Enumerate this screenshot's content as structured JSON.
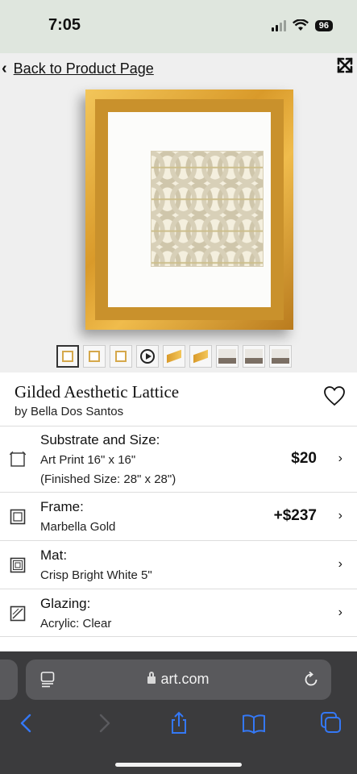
{
  "status_bar": {
    "time": "7:05",
    "battery": "96"
  },
  "nav": {
    "back_label": "Back to Product Page"
  },
  "product": {
    "title": "Gilded Aesthetic Lattice",
    "artist": "by Bella Dos Santos"
  },
  "options": [
    {
      "title": "Substrate and Size:",
      "line1": "Art Print 16\" x 16\"",
      "line2": "(Finished Size: 28\" x 28\")",
      "price": "$20",
      "icon": "substrate-icon"
    },
    {
      "title": "Frame:",
      "line1": "Marbella Gold",
      "price": "+$237",
      "icon": "frame-icon"
    },
    {
      "title": "Mat:",
      "line1": "Crisp Bright White 5\"",
      "price": "",
      "icon": "mat-icon"
    },
    {
      "title": "Glazing:",
      "line1": "Acrylic: Clear",
      "price": "",
      "icon": "glazing-icon"
    }
  ],
  "browser": {
    "url": "art.com"
  },
  "colors": {
    "frame_gold": "#d99a2a",
    "status_bg": "#dfe6de",
    "safari_bg": "#3b3b3d",
    "ios_blue": "#3478f6"
  }
}
